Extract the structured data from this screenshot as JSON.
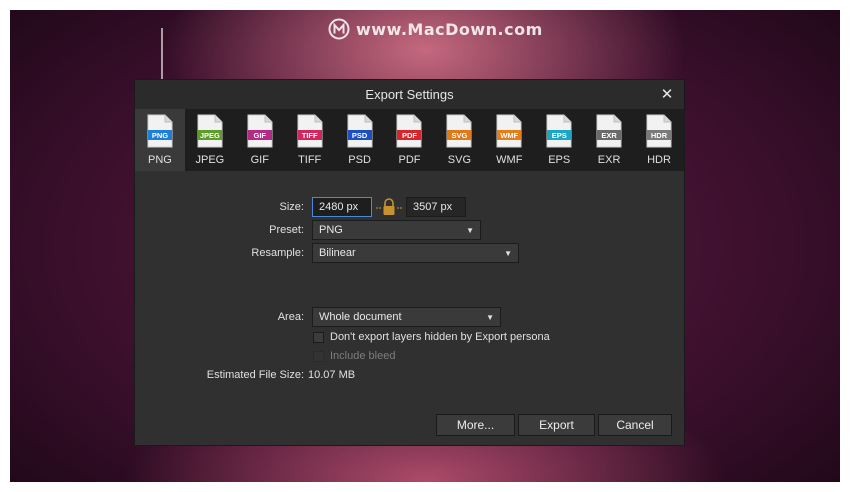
{
  "watermark": {
    "text": "www.MacDown.com",
    "logo_letter": "M"
  },
  "dialog": {
    "title": "Export Settings",
    "close_glyph": "✕"
  },
  "formats": [
    {
      "id": "png",
      "badge": "PNG",
      "label": "PNG",
      "color": "#1e7fd6",
      "selected": true
    },
    {
      "id": "jpeg",
      "badge": "JPEG",
      "label": "JPEG",
      "color": "#5c9e2a"
    },
    {
      "id": "gif",
      "badge": "GIF",
      "label": "GIF",
      "color": "#b52a86"
    },
    {
      "id": "tiff",
      "badge": "TIFF",
      "label": "TIFF",
      "color": "#d0285e"
    },
    {
      "id": "psd",
      "badge": "PSD",
      "label": "PSD",
      "color": "#1c4fc2"
    },
    {
      "id": "pdf",
      "badge": "PDF",
      "label": "PDF",
      "color": "#d7262b"
    },
    {
      "id": "svg",
      "badge": "SVG",
      "label": "SVG",
      "color": "#e07a18"
    },
    {
      "id": "wmf",
      "badge": "WMF",
      "label": "WMF",
      "color": "#e57d1b"
    },
    {
      "id": "eps",
      "badge": "EPS",
      "label": "EPS",
      "color": "#1aa6c4"
    },
    {
      "id": "exr",
      "badge": "EXR",
      "label": "EXR",
      "color": "#6a6a6a"
    },
    {
      "id": "hdr",
      "badge": "HDR",
      "label": "HDR",
      "color": "#7a7a7a"
    }
  ],
  "form": {
    "size_label": "Size:",
    "width_value": "2480 px",
    "height_value": "3507 px",
    "preset_label": "Preset:",
    "preset_value": "PNG",
    "resample_label": "Resample:",
    "resample_value": "Bilinear",
    "area_label": "Area:",
    "area_value": "Whole document",
    "hidden_layers_label": "Don't export layers hidden by Export persona",
    "include_bleed_label": "Include bleed",
    "file_size_label": "Estimated File Size:",
    "file_size_value": "10.07 MB"
  },
  "buttons": {
    "more": "More...",
    "export": "Export",
    "cancel": "Cancel"
  },
  "colors": {
    "accent": "#4a8ad6",
    "lock": "#c8922e"
  }
}
